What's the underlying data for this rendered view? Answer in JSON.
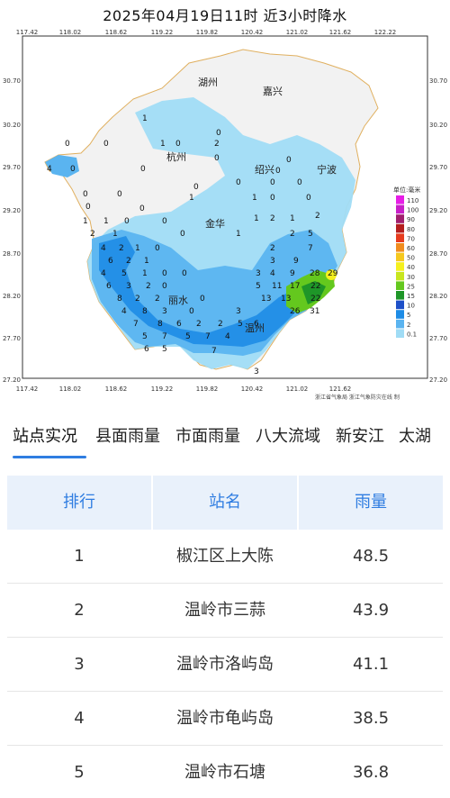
{
  "map": {
    "title": "2025年04月19日11时  近3小时降水",
    "lon_ticks": [
      "117.42",
      "118.02",
      "118.62",
      "119.22",
      "119.82",
      "120.42",
      "121.02",
      "121.62",
      "122.22"
    ],
    "lat_ticks": [
      "30.70",
      "30.20",
      "29.70",
      "29.20",
      "28.70",
      "28.20",
      "27.70",
      "27.20"
    ],
    "cities": [
      "湖州",
      "嘉兴",
      "杭州",
      "绍兴",
      "宁波",
      "金华",
      "丽水",
      "温州"
    ],
    "legend": {
      "title": "单位:毫米",
      "levels": [
        {
          "label": "110",
          "color": "#e61ee6"
        },
        {
          "label": "100",
          "color": "#c81ec8"
        },
        {
          "label": "90",
          "color": "#a01e6e"
        },
        {
          "label": "80",
          "color": "#b41e1e"
        },
        {
          "label": "70",
          "color": "#e63c1e"
        },
        {
          "label": "60",
          "color": "#f08c1e"
        },
        {
          "label": "50",
          "color": "#f5c81e"
        },
        {
          "label": "40",
          "color": "#f5f01e"
        },
        {
          "label": "30",
          "color": "#c8e61e"
        },
        {
          "label": "25",
          "color": "#64c81e"
        },
        {
          "label": "15",
          "color": "#1e9628"
        },
        {
          "label": "10",
          "color": "#1e50c8"
        },
        {
          "label": "5",
          "color": "#1e8ce6"
        },
        {
          "label": "2",
          "color": "#5ab4f0"
        },
        {
          "label": "0.1",
          "color": "#a0dcf5"
        }
      ]
    },
    "credit": "浙江省气象局   浙江气象防灾在线  制",
    "colors": {
      "light": "#a0dcf5",
      "medium": "#5ab4f0",
      "blue": "#1e8ce6",
      "green": "#64c81e",
      "dark_green": "#1e9628",
      "yellow": "#f5f01e",
      "boundary": "#e0b060",
      "no_rain": "#ffffff"
    }
  },
  "tabs": [
    {
      "label": "站点实况",
      "active": true
    },
    {
      "label": "县面雨量",
      "active": false
    },
    {
      "label": "市面雨量",
      "active": false
    },
    {
      "label": "八大流域",
      "active": false
    },
    {
      "label": "新安江",
      "active": false
    },
    {
      "label": "太湖",
      "active": false
    }
  ],
  "table": {
    "headers": {
      "rank": "排行",
      "name": "站名",
      "rain": "雨量"
    },
    "rows": [
      {
        "rank": "1",
        "name": "椒江区上大陈",
        "rain": "48.5"
      },
      {
        "rank": "2",
        "name": "温岭市三蒜",
        "rain": "43.9"
      },
      {
        "rank": "3",
        "name": "温岭市洛屿岛",
        "rain": "41.1"
      },
      {
        "rank": "4",
        "name": "温岭市龟屿岛",
        "rain": "38.5"
      },
      {
        "rank": "5",
        "name": "温岭市石塘",
        "rain": "36.8"
      }
    ]
  },
  "accent_color": "#2f7de1"
}
